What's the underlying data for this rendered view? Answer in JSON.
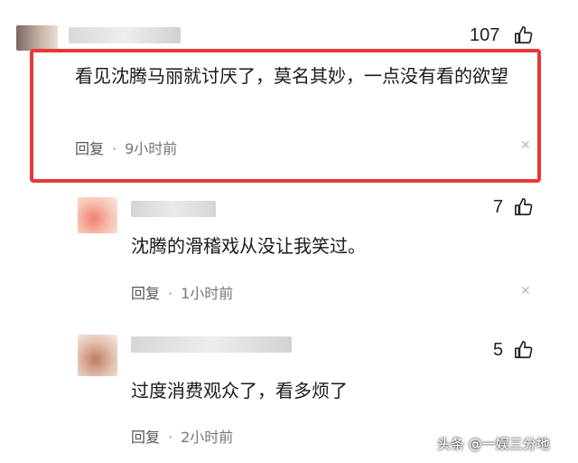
{
  "comments": [
    {
      "likes": "107",
      "text": "看见沈腾马丽就讨厌了，莫名其妙，一点没有看的欲望",
      "reply_label": "回复",
      "separator": "·",
      "time": "9小时前"
    },
    {
      "likes": "7",
      "text": "沈腾的滑稽戏从没让我笑过。",
      "reply_label": "回复",
      "separator": "·",
      "time": "1小时前"
    },
    {
      "likes": "5",
      "text": "过度消费观众了，看多烦了",
      "reply_label": "回复",
      "separator": "·",
      "time": "2小时前"
    }
  ],
  "watermark": "头条 @一娱三分地",
  "colors": {
    "highlight": "#e53935"
  },
  "icons": {
    "like": "thumbs-up-icon",
    "close": "close-icon"
  }
}
